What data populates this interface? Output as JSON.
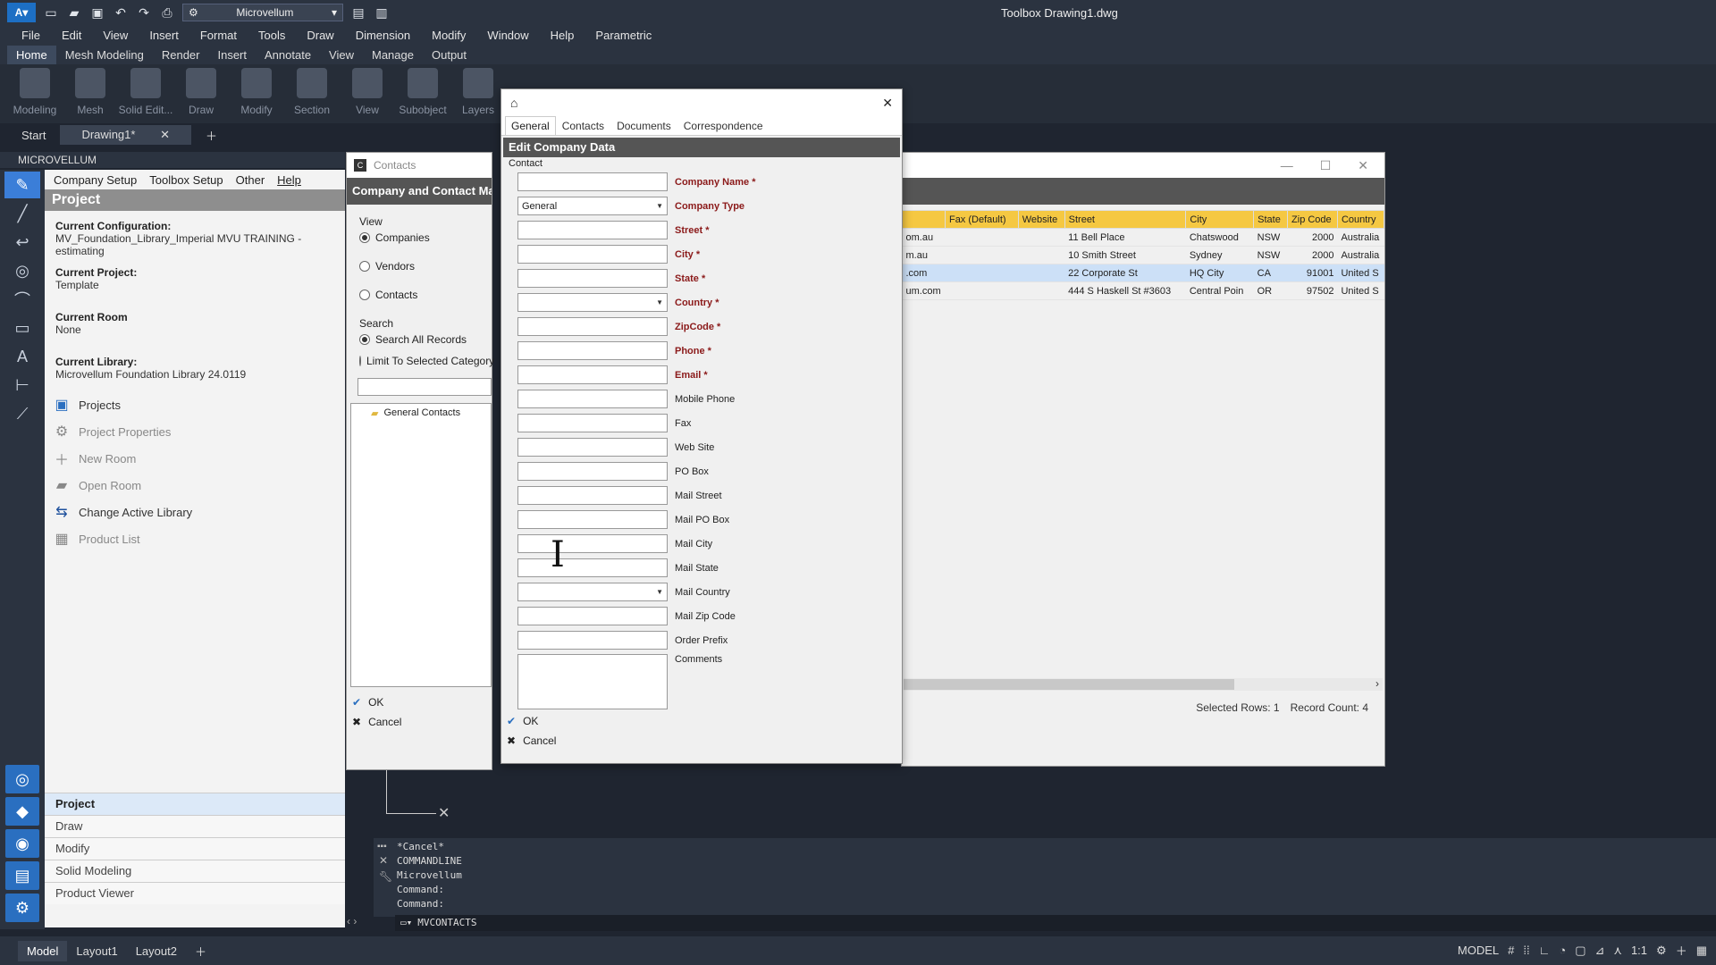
{
  "titlebar": {
    "workspace": "Microvellum",
    "title": "Toolbox   Drawing1.dwg"
  },
  "menubar": {
    "items": [
      "File",
      "Edit",
      "View",
      "Insert",
      "Format",
      "Tools",
      "Draw",
      "Dimension",
      "Modify",
      "Window",
      "Help",
      "Parametric"
    ]
  },
  "ribbon_tabs": {
    "items": [
      "Home",
      "Mesh Modeling",
      "Render",
      "Insert",
      "Annotate",
      "View",
      "Manage",
      "Output"
    ]
  },
  "ribbon": {
    "buttons": [
      "Modeling",
      "Mesh",
      "Solid Edit...",
      "Draw",
      "Modify",
      "Section",
      "View",
      "Subobject",
      "Layers"
    ]
  },
  "doc_tabs": {
    "start": "Start",
    "drawing": "Drawing1*"
  },
  "palette": {
    "title": "MICROVELLUM"
  },
  "mv": {
    "menu": [
      "Company Setup",
      "Toolbox Setup",
      "Other",
      "Help"
    ],
    "header": "Project",
    "config_label": "Current Configuration:",
    "config_value": "MV_Foundation_Library_Imperial MVU TRAINING - estimating",
    "project_label": "Current Project:",
    "project_value": "Template",
    "room_label": "Current Room",
    "room_value": "None",
    "library_label": "Current Library:",
    "library_value": "Microvellum Foundation Library 24.0119",
    "links": [
      "Projects",
      "Project Properties",
      "New Room",
      "Open Room",
      "Change Active Library",
      "Product List"
    ],
    "tabs": [
      "Project",
      "Draw",
      "Modify",
      "Solid Modeling",
      "Product Viewer"
    ]
  },
  "contacts": {
    "title": "Contacts",
    "banner": "Company and Contact Ma",
    "view_label": "View",
    "view_options": [
      "Companies",
      "Vendors",
      "Contacts"
    ],
    "search_label": "Search",
    "search_options": [
      "Search All Records",
      "Limit To Selected Category"
    ],
    "tree_item": "General Contacts",
    "ok": "OK",
    "cancel": "Cancel"
  },
  "table": {
    "columns": [
      "Fax (Default)",
      "Website",
      "Street",
      "City",
      "State",
      "Zip Code",
      "Country"
    ],
    "rows": [
      {
        "email": "om.au",
        "fax": "",
        "web": "",
        "street": "11 Bell Place",
        "city": "Chatswood",
        "state": "NSW",
        "zip": "2000",
        "country": "Australia"
      },
      {
        "email": "m.au",
        "fax": "",
        "web": "",
        "street": "10 Smith Street",
        "city": "Sydney",
        "state": "NSW",
        "zip": "2000",
        "country": "Australia"
      },
      {
        "email": ".com",
        "fax": "",
        "web": "",
        "street": "22 Corporate St",
        "city": "HQ City",
        "state": "CA",
        "zip": "91001",
        "country": "United S"
      },
      {
        "email": "um.com",
        "fax": "",
        "web": "",
        "street": "444 S Haskell St #3603",
        "city": "Central Poin",
        "state": "OR",
        "zip": "97502",
        "country": "United S"
      }
    ],
    "selected_rows": "Selected Rows: 1",
    "record_count": "Record Count: 4"
  },
  "edit": {
    "tabs": [
      "General",
      "Contacts",
      "Documents",
      "Correspondence"
    ],
    "banner": "Edit Company Data",
    "sub": "Contact",
    "fields": [
      {
        "label": "Company Name *",
        "req": true,
        "value": "",
        "dd": false
      },
      {
        "label": "Company Type",
        "req": true,
        "value": "General",
        "dd": true
      },
      {
        "label": "Street *",
        "req": true,
        "value": "",
        "dd": false
      },
      {
        "label": "City *",
        "req": true,
        "value": "",
        "dd": false
      },
      {
        "label": "State *",
        "req": true,
        "value": "",
        "dd": false
      },
      {
        "label": "Country *",
        "req": true,
        "value": "",
        "dd": true
      },
      {
        "label": "ZipCode *",
        "req": true,
        "value": "",
        "dd": false
      },
      {
        "label": "Phone *",
        "req": true,
        "value": "",
        "dd": false
      },
      {
        "label": "Email *",
        "req": true,
        "value": "",
        "dd": false
      },
      {
        "label": "Mobile Phone",
        "req": false,
        "value": "",
        "dd": false
      },
      {
        "label": "Fax",
        "req": false,
        "value": "",
        "dd": false
      },
      {
        "label": "Web Site",
        "req": false,
        "value": "",
        "dd": false
      },
      {
        "label": "PO Box",
        "req": false,
        "value": "",
        "dd": false
      },
      {
        "label": "Mail Street",
        "req": false,
        "value": "",
        "dd": false
      },
      {
        "label": "Mail PO Box",
        "req": false,
        "value": "",
        "dd": false
      },
      {
        "label": "Mail City",
        "req": false,
        "value": "",
        "dd": false
      },
      {
        "label": "Mail State",
        "req": false,
        "value": "",
        "dd": false
      },
      {
        "label": "Mail Country",
        "req": false,
        "value": "",
        "dd": true
      },
      {
        "label": "Mail Zip Code",
        "req": false,
        "value": "",
        "dd": false
      },
      {
        "label": "Order Prefix",
        "req": false,
        "value": "",
        "dd": false
      }
    ],
    "comments_label": "Comments",
    "ok": "OK",
    "cancel": "Cancel"
  },
  "command": {
    "history": "*Cancel*\nCOMMANDLINE\nMicrovellum\nCommand:\nCommand:",
    "input": "MVCONTACTS"
  },
  "status": {
    "layouts": [
      "Model",
      "Layout1",
      "Layout2"
    ],
    "model": "MODEL",
    "scale": "1:1"
  }
}
